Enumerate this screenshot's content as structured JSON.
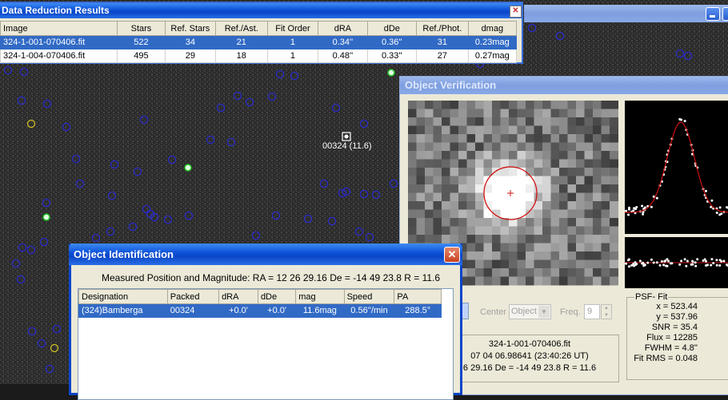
{
  "reduction": {
    "title": "Data Reduction Results",
    "close_glyph": "✕",
    "columns": [
      "Image",
      "Stars",
      "Ref. Stars",
      "Ref./Ast.",
      "Fit Order",
      "dRA",
      "dDe",
      "Ref./Phot.",
      "dmag"
    ],
    "rows": [
      [
        "324-1-001-070406.fit",
        "522",
        "34",
        "21",
        "1",
        "0.34''",
        "0.36''",
        "31",
        "0.23mag"
      ],
      [
        "324-1-004-070406.fit",
        "495",
        "29",
        "18",
        "1",
        "0.48''",
        "0.33''",
        "27",
        "0.27mag"
      ]
    ]
  },
  "sky": {
    "object_label": "00324 (11.6)"
  },
  "verification": {
    "title": "Object Verification",
    "controls": {
      "center_label": "Center",
      "center_value": "Object",
      "freq_label": "Freq.",
      "freq_value": "9"
    },
    "info_lines": [
      "324-1-001-070406.fit",
      "07 04 06.98641 (23:40:26 UT)",
      "6 29.16   De = -14 49 23.8   R = 11.6"
    ],
    "psf": {
      "group_label": "PSF- Fit",
      "lines": [
        "x = 523.44",
        "y = 537.96",
        "SNR = 35.4",
        "Flux = 12285",
        "FWHM = 4.8''",
        "Fit RMS = 0.048"
      ]
    }
  },
  "identification": {
    "title": "Object Identification",
    "close_glyph": "✕",
    "measured": "Measured Position and Magnitude:  RA = 12 26 29.16   De = -14 49 23.8   R = 11.6",
    "columns": [
      "Designation",
      "Packed",
      "dRA",
      "dDe",
      "mag",
      "Speed",
      "PA"
    ],
    "rows": [
      [
        "(324)Bamberga",
        "00324",
        "+0.0'",
        "+0.0'",
        "11.6mag",
        "0.56''/min",
        "288.5°"
      ]
    ]
  },
  "colors": {
    "title_active": "#0a46c8",
    "selection": "#316ac5",
    "star_circle": "#2a2ac8",
    "psf_curve": "#d01010"
  }
}
